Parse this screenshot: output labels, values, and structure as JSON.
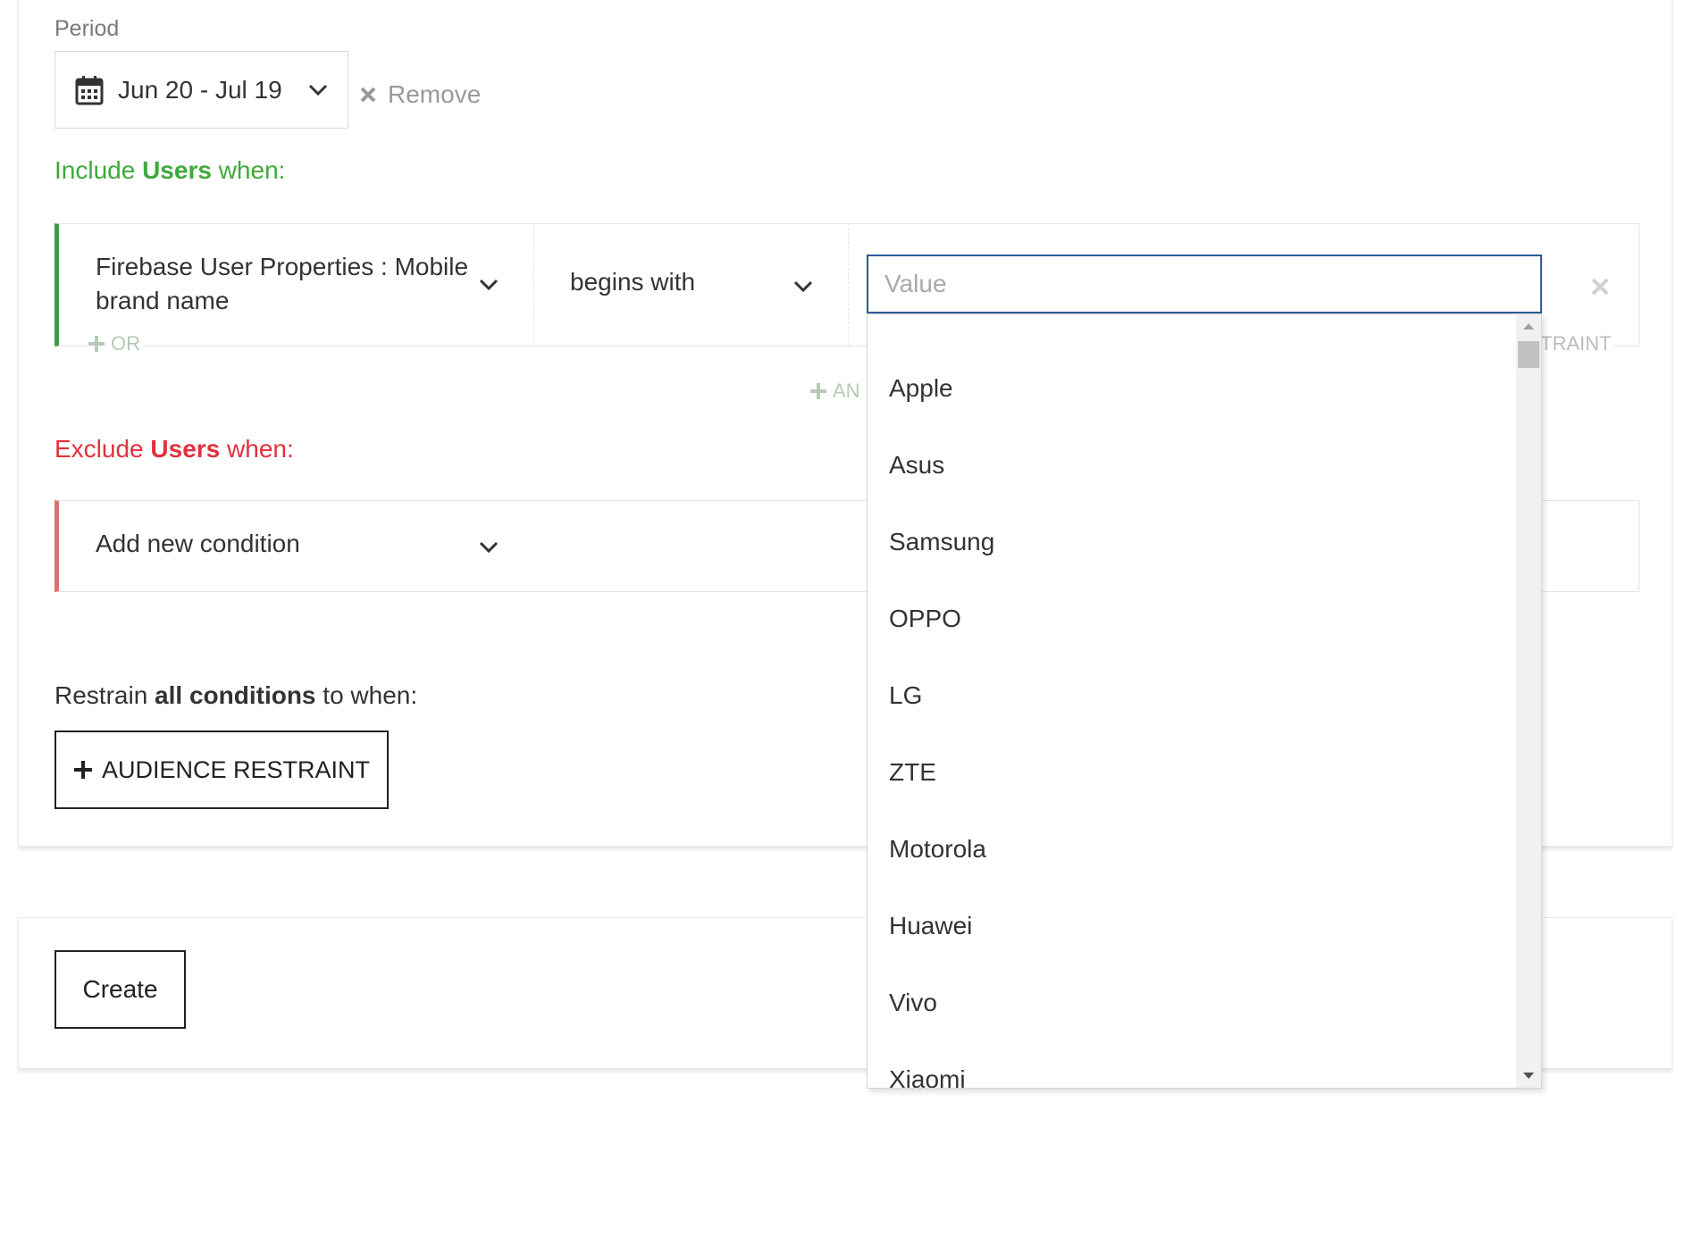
{
  "period": {
    "label": "Period",
    "value": "Jun 20 - Jul 19",
    "remove_label": "Remove"
  },
  "include": {
    "prefix": "Include ",
    "entity": "Users",
    "suffix": " when:",
    "color": "#3eaa3a",
    "condition": {
      "property": "Firebase User Properties : Mobile brand name",
      "operator": "begins with",
      "value_placeholder": "Value"
    },
    "or_label": "OR",
    "and_label": "AN",
    "restraint_tail": "TRAINT"
  },
  "exclude": {
    "prefix": "Exclude ",
    "entity": "Users",
    "suffix": " when:",
    "color": "#e0323e",
    "placeholder": "Add new condition"
  },
  "restrain": {
    "prefix": "Restrain ",
    "bold": "all conditions",
    "suffix": " to when:",
    "button_label": "AUDIENCE RESTRAINT"
  },
  "actions": {
    "create_label": "Create"
  },
  "dropdown": {
    "options": [
      "Apple",
      "Asus",
      "Samsung",
      "OPPO",
      "LG",
      "ZTE",
      "Motorola",
      "Huawei",
      "Vivo",
      "Xiaomi"
    ]
  },
  "icons": {
    "calendar": "calendar-icon",
    "chevron": "chevron-down-icon",
    "close": "close-icon",
    "plus": "plus-icon"
  }
}
